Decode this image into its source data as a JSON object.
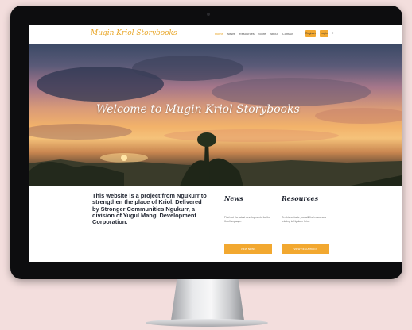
{
  "site": {
    "logo": "Mugin Kriol Storybooks",
    "nav": [
      "Home",
      "News",
      "Resources",
      "Store",
      "About",
      "Contact"
    ],
    "nav_button_1": "Register",
    "nav_button_2": "Login"
  },
  "hero": {
    "title": "Welcome to Mugin Kriol Storybooks"
  },
  "intro": "This website is a project from Ngukurr to strengthen the place of Kriol. Delivered by Stronger Communities Ngukurr, a division of Yugul Mangi Development Corporation.",
  "news": {
    "title": "News",
    "text": "Find out the latest developments for the Kriol language.",
    "button": "VIEW NEWS"
  },
  "resources": {
    "title": "Resources",
    "text": "On this website you will find resources relating to Ngukurr Kriol.",
    "button": "VIEW RESOURCES"
  },
  "colors": {
    "accent": "#f2a830",
    "logo": "#e8a628",
    "background": "#f3dedd",
    "bezel": "#0d0d0f"
  }
}
